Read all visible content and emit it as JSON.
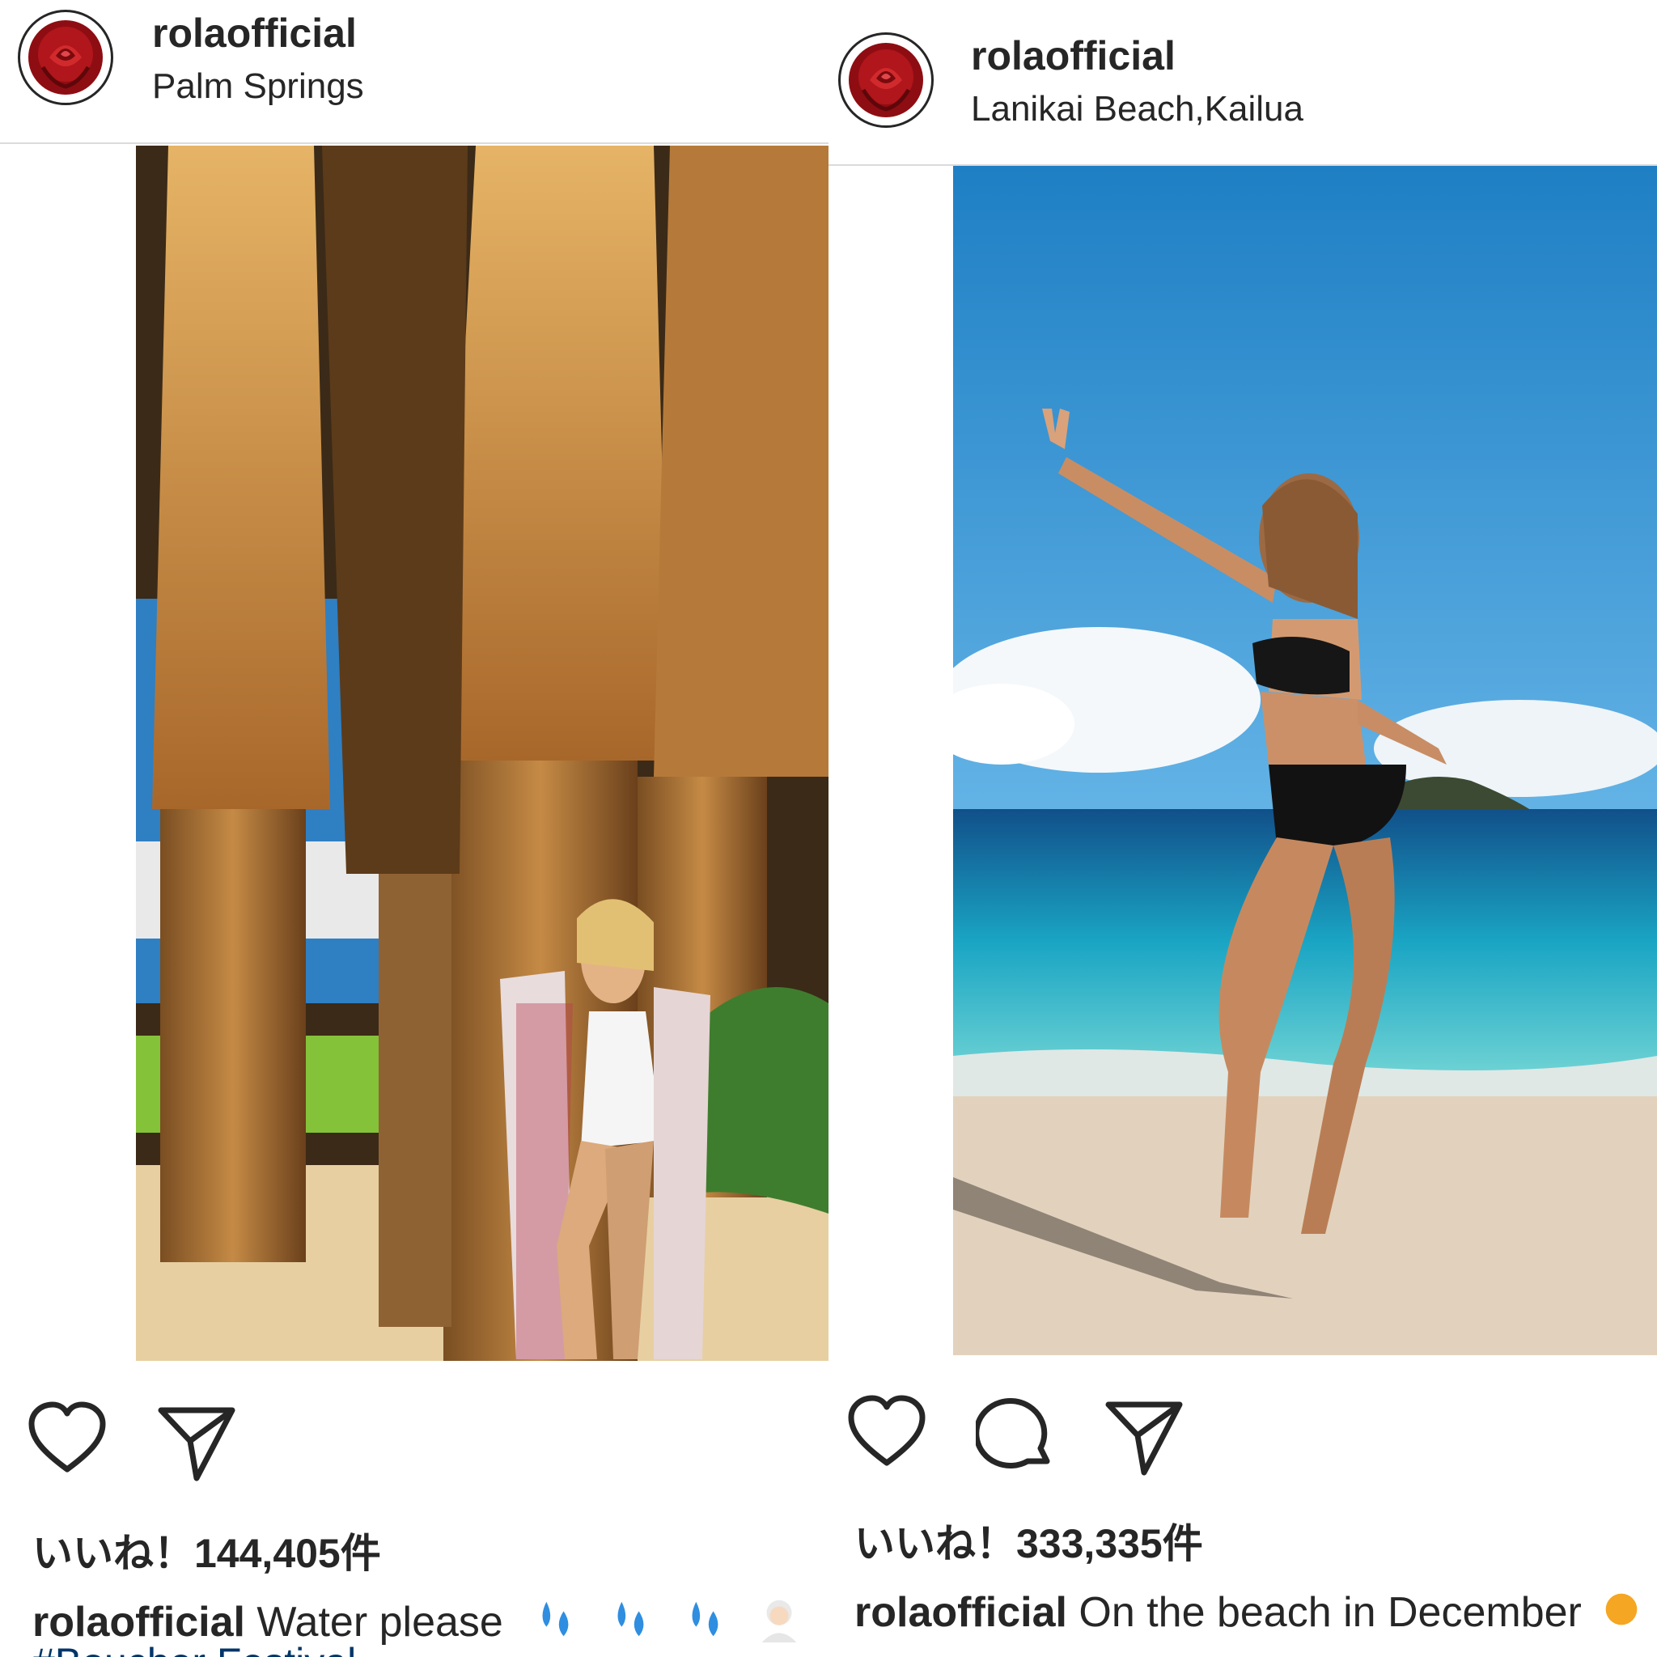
{
  "posts": [
    {
      "username": "rolaofficial",
      "location": "Palm Springs",
      "likes": "いいね！144,405件",
      "caption_user": "rolaofficial",
      "caption_text": " Water please",
      "caption_emojis": [
        "sweat-droplets-emoji",
        "sweat-droplets-emoji",
        "sweat-droplets-emoji",
        "person-white-hair-emoji"
      ],
      "hashtag": "#Boucher Festival",
      "icons": [
        "heart-icon",
        "paper-plane-icon"
      ]
    },
    {
      "username": "rolaofficial",
      "location": "Lanikai Beach,Kailua",
      "likes": "いいね！333,335件",
      "caption_user": "rolaofficial",
      "caption_text": " On the beach in December",
      "caption_emojis": [
        "sun-emoji"
      ],
      "icons": [
        "heart-icon",
        "comment-icon",
        "paper-plane-icon"
      ]
    }
  ],
  "colors": {
    "text": "#262626",
    "divider": "#dbdbdb",
    "hashtag": "#003569",
    "avatar_rose": "#b0161b"
  }
}
